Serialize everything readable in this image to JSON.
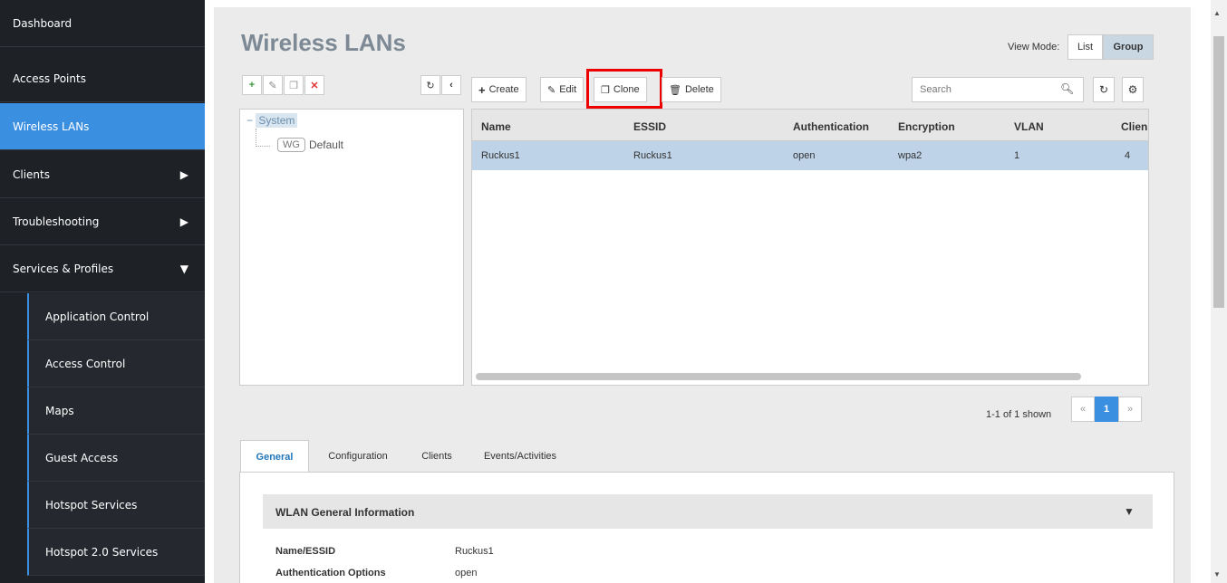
{
  "sidebar": {
    "items": [
      {
        "label": "Dashboard"
      },
      {
        "label": "Access Points"
      },
      {
        "label": "Wireless LANs"
      },
      {
        "label": "Clients",
        "arrow": "▶"
      },
      {
        "label": "Troubleshooting",
        "arrow": "▶"
      },
      {
        "label": "Services & Profiles",
        "arrow": "▼"
      }
    ],
    "sub_items": [
      {
        "label": "Application Control"
      },
      {
        "label": "Access Control"
      },
      {
        "label": "Maps"
      },
      {
        "label": "Guest Access"
      },
      {
        "label": "Hotspot Services"
      },
      {
        "label": "Hotspot 2.0 Services"
      }
    ]
  },
  "header": {
    "title": "Wireless LANs",
    "view_mode_label": "View Mode:",
    "view_mode_list": "List",
    "view_mode_group": "Group"
  },
  "tree": {
    "root": "System",
    "child_badge": "WG",
    "child_label": "Default"
  },
  "toolbar": {
    "create": "Create",
    "edit": "Edit",
    "clone": "Clone",
    "delete": "Delete",
    "search_placeholder": "Search"
  },
  "grid": {
    "columns": [
      "Name",
      "ESSID",
      "Authentication",
      "Encryption",
      "VLAN",
      "Clien"
    ],
    "rows": [
      [
        "Ruckus1",
        "Ruckus1",
        "open",
        "wpa2",
        "1",
        "4"
      ]
    ]
  },
  "pagination": {
    "info": "1-1 of 1 shown",
    "prev": "«",
    "current": "1",
    "next": "»"
  },
  "tabs": [
    "General",
    "Configuration",
    "Clients",
    "Events/Activities"
  ],
  "details": {
    "section_title": "WLAN General Information",
    "rows": [
      {
        "label": "Name/ESSID",
        "value": "Ruckus1"
      },
      {
        "label": "Authentication Options",
        "value": "open"
      }
    ]
  },
  "colors": {
    "sidebar_bg": "#1e2126",
    "accent": "#3b8fe0",
    "selected_row": "#bed3e8",
    "highlight": "#ee0000"
  }
}
